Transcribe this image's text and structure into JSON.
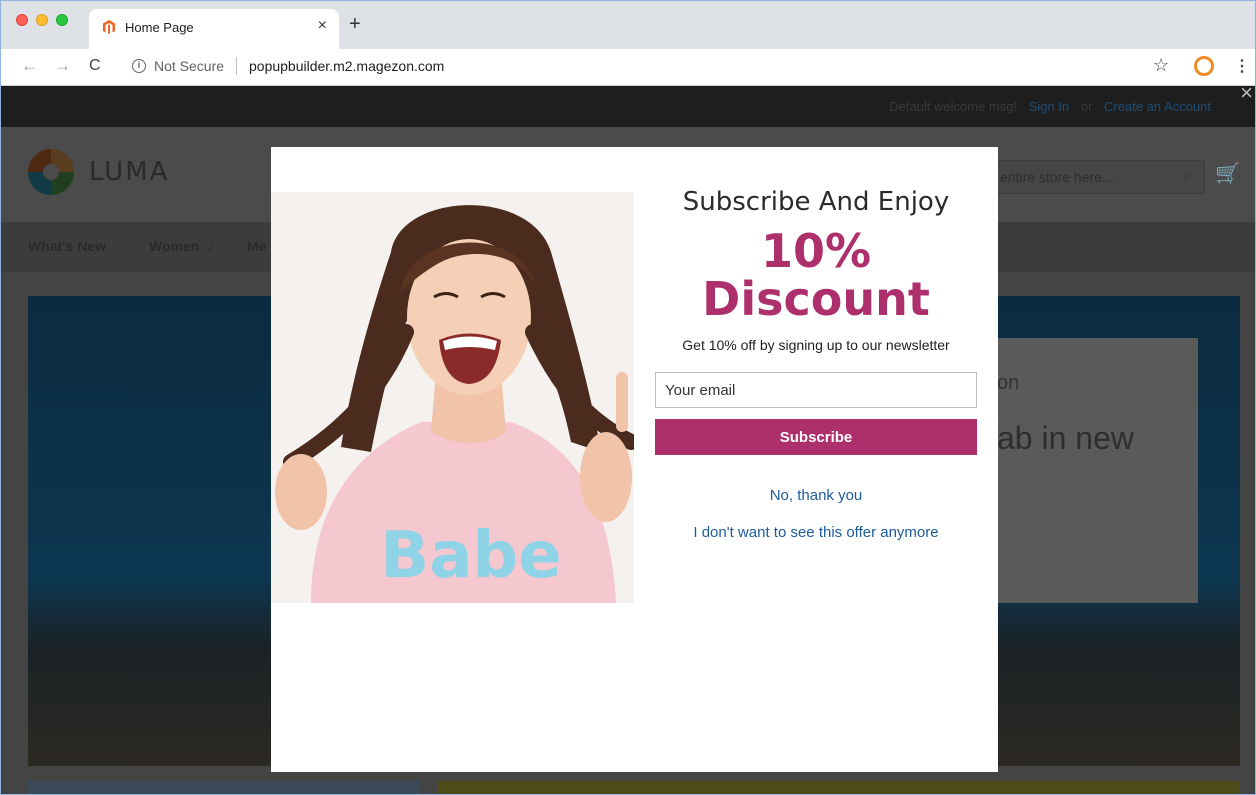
{
  "browser": {
    "tab_title": "Home Page",
    "tab_close": "×",
    "new_tab": "+",
    "security_label": "Not Secure",
    "url": "popupbuilder.m2.magezon.com",
    "icons": [
      "magento-favicon-icon",
      "back-icon",
      "forward-icon",
      "reload-icon",
      "info-icon",
      "star-icon",
      "extension-icon",
      "menu-icon"
    ]
  },
  "store": {
    "welcome": "Default welcome msg!",
    "sign_in": "Sign In",
    "or": "or",
    "create_account": "Create an Account",
    "logo_text": "LUMA",
    "search_placeholder": "entire store here...",
    "nav": [
      "What's New",
      "Women",
      "Me"
    ],
    "hero_partial_1": "on",
    "hero_partial_2": "ab in new"
  },
  "popup": {
    "title": "Subscribe And Enjoy",
    "percent": "10%",
    "discount": "Discount",
    "subtitle": "Get 10% off by signing up to our newsletter",
    "email_placeholder": "Your email",
    "subscribe_label": "Subscribe",
    "no_thanks": "No, thank you",
    "never_show": "I don't want to see this offer anymore",
    "shirt_text": "Babe",
    "accent_color": "#ad2f6c",
    "link_color": "#1d5b9e"
  }
}
